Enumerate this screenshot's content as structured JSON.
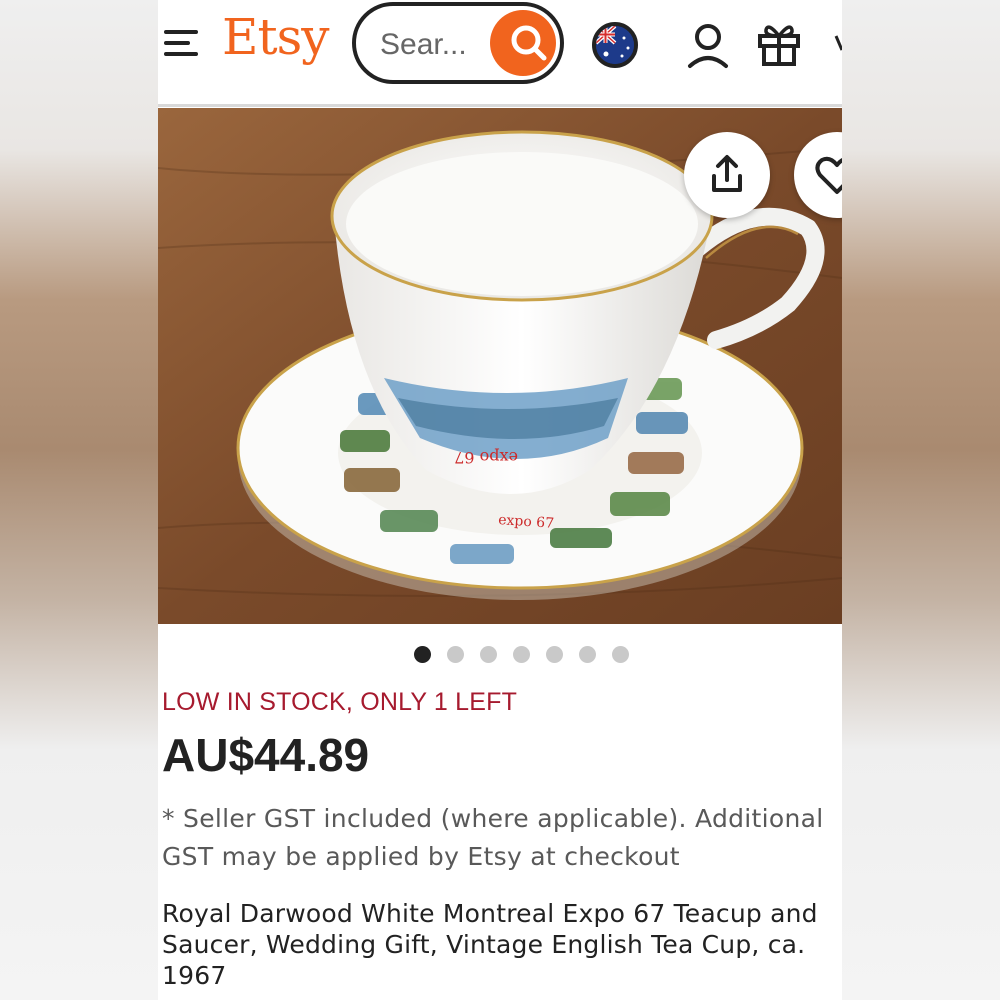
{
  "header": {
    "logo": "Etsy",
    "search": {
      "placeholder": "Sear..."
    },
    "icons": [
      "menu-icon",
      "search-icon",
      "australia-flag-icon",
      "user-icon",
      "gift-icon"
    ]
  },
  "product": {
    "image_alt": "Royal Darwood Expo 67 teacup and saucer on a wooden table",
    "image_count": 7,
    "active_image": 1,
    "stock_notice": "LOW IN STOCK, ONLY 1 LEFT",
    "price": "AU$44.89",
    "tax_note": "* Seller GST included (where applicable). Additional GST may be applied by Etsy at checkout",
    "title": "Royal Darwood White Montreal Expo 67 Teacup and Saucer, Wedding Gift, Vintage English Tea Cup, ca. 1967"
  },
  "colors": {
    "brand": "#f1641e",
    "stock_notice": "#a61a2e",
    "text_primary": "#222222",
    "text_secondary": "#595959"
  }
}
